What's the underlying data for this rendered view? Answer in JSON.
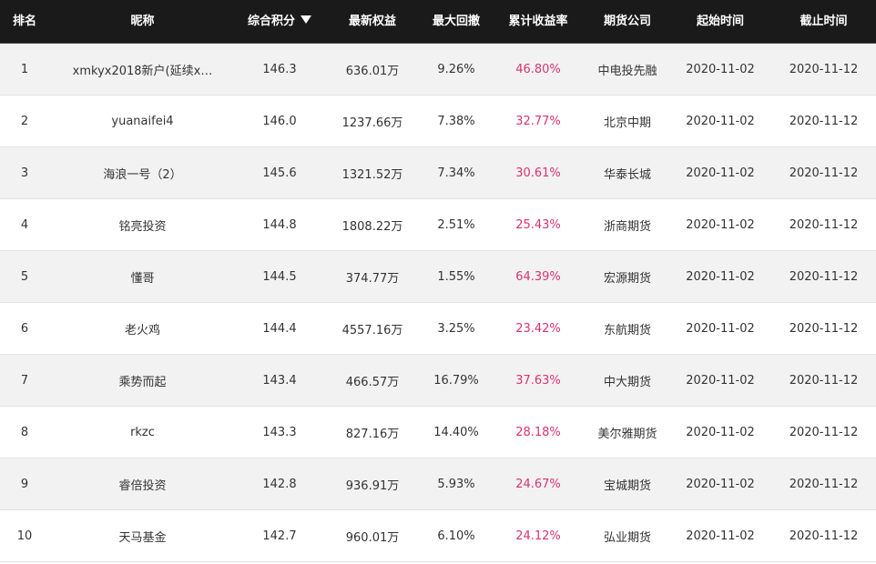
{
  "header": {
    "rank": "排名",
    "nickname": "昵称",
    "score": "综合积分",
    "equity": "最新权益",
    "max_drawdown": "最大回撤",
    "cumulative_return": "累计收益率",
    "broker": "期货公司",
    "start_time": "起始时间",
    "end_time": "截止时间"
  },
  "rows": [
    {
      "rank": "1",
      "nickname": "xmkyx2018新户(延续x…",
      "score": "146.3",
      "equity": "636.01万",
      "max_drawdown": "9.26%",
      "cumulative_return": "46.80%",
      "broker": "中电投先融",
      "start_time": "2020-11-02",
      "end_time": "2020-11-12"
    },
    {
      "rank": "2",
      "nickname": "yuanaifei4",
      "score": "146.0",
      "equity": "1237.66万",
      "max_drawdown": "7.38%",
      "cumulative_return": "32.77%",
      "broker": "北京中期",
      "start_time": "2020-11-02",
      "end_time": "2020-11-12"
    },
    {
      "rank": "3",
      "nickname": "海浪一号（2）",
      "score": "145.6",
      "equity": "1321.52万",
      "max_drawdown": "7.34%",
      "cumulative_return": "30.61%",
      "broker": "华泰长城",
      "start_time": "2020-11-02",
      "end_time": "2020-11-12"
    },
    {
      "rank": "4",
      "nickname": "铭亮投资",
      "score": "144.8",
      "equity": "1808.22万",
      "max_drawdown": "2.51%",
      "cumulative_return": "25.43%",
      "broker": "浙商期货",
      "start_time": "2020-11-02",
      "end_time": "2020-11-12"
    },
    {
      "rank": "5",
      "nickname": "懂哥",
      "score": "144.5",
      "equity": "374.77万",
      "max_drawdown": "1.55%",
      "cumulative_return": "64.39%",
      "broker": "宏源期货",
      "start_time": "2020-11-02",
      "end_time": "2020-11-12"
    },
    {
      "rank": "6",
      "nickname": "老火鸡",
      "score": "144.4",
      "equity": "4557.16万",
      "max_drawdown": "3.25%",
      "cumulative_return": "23.42%",
      "broker": "东航期货",
      "start_time": "2020-11-02",
      "end_time": "2020-11-12"
    },
    {
      "rank": "7",
      "nickname": "乘势而起",
      "score": "143.4",
      "equity": "466.57万",
      "max_drawdown": "16.79%",
      "cumulative_return": "37.63%",
      "broker": "中大期货",
      "start_time": "2020-11-02",
      "end_time": "2020-11-12"
    },
    {
      "rank": "8",
      "nickname": "rkzc",
      "score": "143.3",
      "equity": "827.16万",
      "max_drawdown": "14.40%",
      "cumulative_return": "28.18%",
      "broker": "美尔雅期货",
      "start_time": "2020-11-02",
      "end_time": "2020-11-12"
    },
    {
      "rank": "9",
      "nickname": "睿倍投资",
      "score": "142.8",
      "equity": "936.91万",
      "max_drawdown": "5.93%",
      "cumulative_return": "24.67%",
      "broker": "宝城期货",
      "start_time": "2020-11-02",
      "end_time": "2020-11-12"
    },
    {
      "rank": "10",
      "nickname": "天马基金",
      "score": "142.7",
      "equity": "960.01万",
      "max_drawdown": "6.10%",
      "cumulative_return": "24.12%",
      "broker": "弘业期货",
      "start_time": "2020-11-02",
      "end_time": "2020-11-12"
    }
  ],
  "icons": {
    "sort": "sort-descending-icon"
  },
  "colors": {
    "header_bg": "#1a1a1a",
    "return_text": "#d8336f",
    "stripe": "#f2f2f2"
  }
}
